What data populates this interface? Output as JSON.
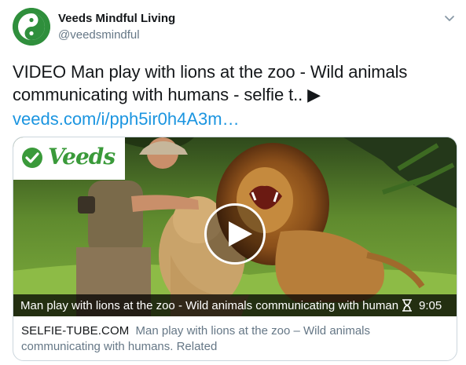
{
  "account": {
    "display_name": "Veeds Mindful Living",
    "handle": "@veedsmindful",
    "avatar_icon": "yin-yang-icon",
    "brand_color": "#2f8f3c"
  },
  "tweet": {
    "text": "VIDEO Man play with lions at the zoo - Wild animals communicating with humans - selfie t.. ▶",
    "link": "veeds.com/i/pph5ir0h4A3m…",
    "link_color": "#1b95e0"
  },
  "card": {
    "logo_text": "Veeds",
    "logo_color": "#3a9a3a",
    "video_title": "Man play with lions at the zoo - Wild animals communicating with human",
    "duration": "9:05",
    "duration_icon": "hourglass-icon",
    "play_icon": "play-icon",
    "domain": "SELFIE-TUBE.COM",
    "description": "Man play with lions at the zoo – Wild animals communicating with humans. Related"
  },
  "menu_icon": "chevron-down-icon"
}
